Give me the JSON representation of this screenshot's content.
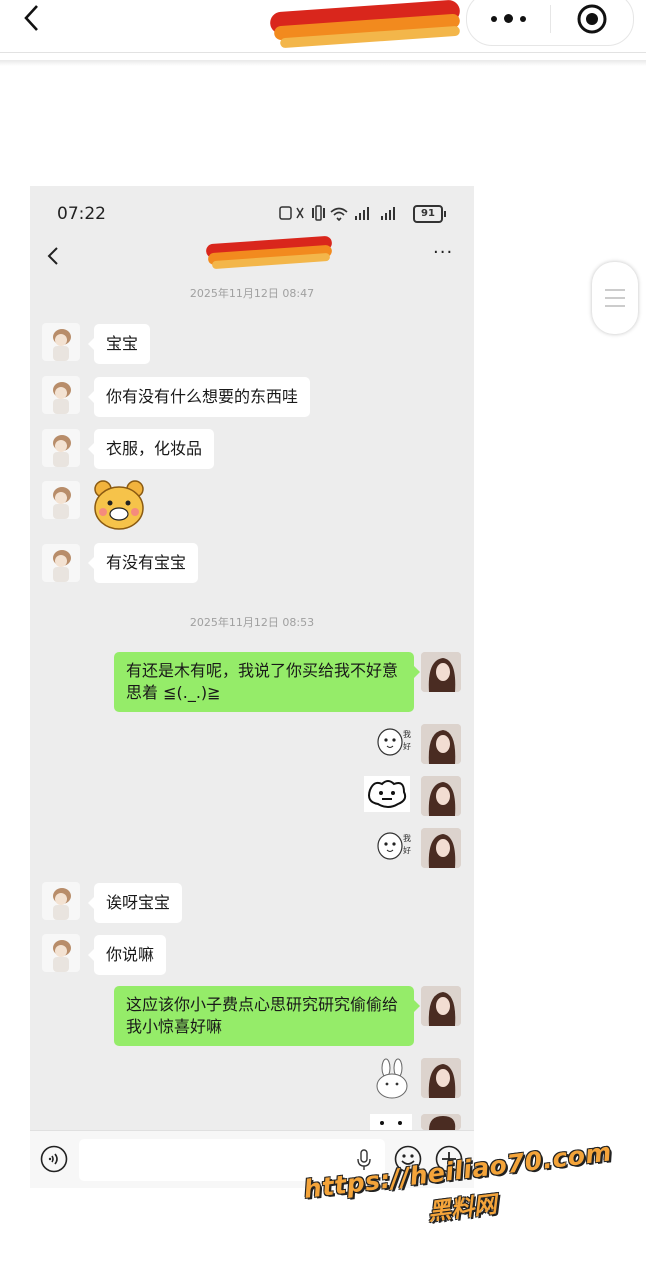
{
  "status_bar": {
    "time": "07:22",
    "battery": "91"
  },
  "chat": {
    "timestamps": [
      "2025年11月12日 08:47",
      "2025年11月12日 08:53"
    ],
    "messages_left_1": [
      "宝宝",
      "你有没有什么想要的东西哇",
      "衣服，化妆品"
    ],
    "message_left_after_sticker": "有没有宝宝",
    "message_right_1": "有还是木有呢，我说了你买给我不好意思着 ≦(._.)≧",
    "messages_left_2": [
      "诶呀宝宝",
      "你说嘛"
    ],
    "message_right_2": "这应该你小子费点心思研究研究偷偷给我小惊喜好嘛",
    "sticker_text": "我好"
  },
  "watermark": {
    "url": "https://heiliao70.com",
    "name": "黑料网"
  },
  "icons": [
    "back-icon",
    "more-dots-icon",
    "target-icon",
    "voice-icon",
    "mic-icon",
    "emoji-icon",
    "plus-icon"
  ]
}
